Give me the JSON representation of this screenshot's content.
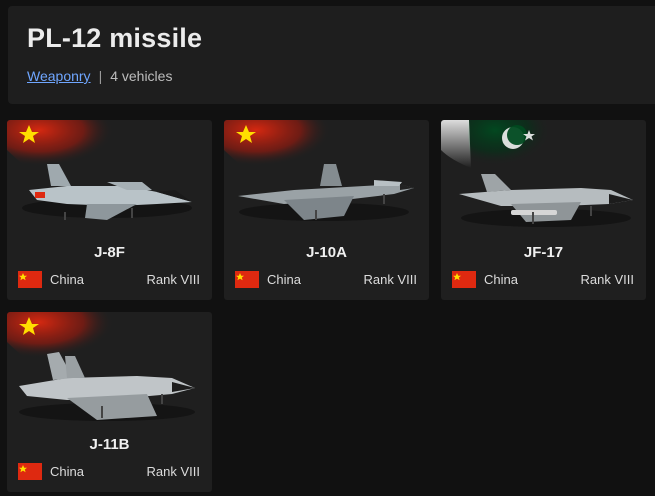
{
  "header": {
    "title": "PL-12 missile",
    "category_link": "Weaponry",
    "separator": "|",
    "count_label": "4 vehicles"
  },
  "vehicles": [
    {
      "name": "J-8F",
      "country": "China",
      "rank": "Rank VIII",
      "flag_icon": "china-flag-icon",
      "banner_flag": "china"
    },
    {
      "name": "J-10A",
      "country": "China",
      "rank": "Rank VIII",
      "flag_icon": "china-flag-icon",
      "banner_flag": "china"
    },
    {
      "name": "JF-17",
      "country": "China",
      "rank": "Rank VIII",
      "flag_icon": "china-flag-icon",
      "banner_flag": "pakistan"
    },
    {
      "name": "J-11B",
      "country": "China",
      "rank": "Rank VIII",
      "flag_icon": "china-flag-icon",
      "banner_flag": "china"
    }
  ],
  "colors": {
    "page_background": "#111111",
    "card_background": "#1f1f1f",
    "link": "#6fa6ff",
    "china_red": "#de2910",
    "china_yellow": "#ffde00",
    "pakistan_green": "#01411c"
  }
}
